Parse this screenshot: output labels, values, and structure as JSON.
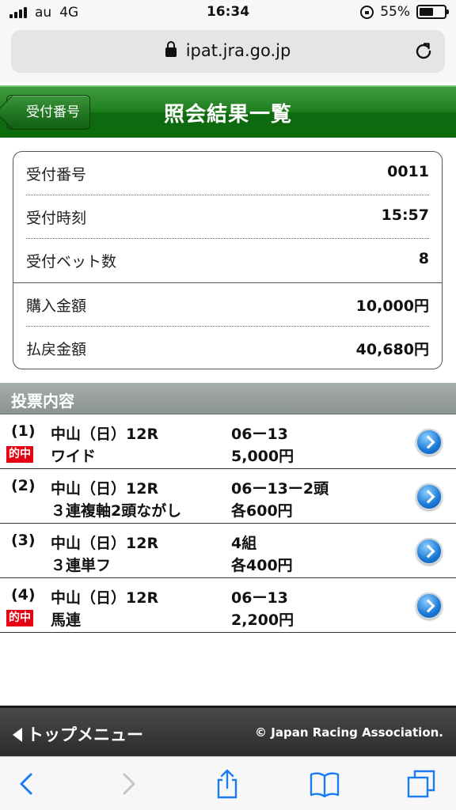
{
  "status_bar": {
    "carrier": "au",
    "network": "4G",
    "time": "16:34",
    "battery": "55%",
    "battery_level": 0.55
  },
  "browser": {
    "url": "ipat.jra.go.jp"
  },
  "header": {
    "back_label": "受付番号",
    "title": "照会結果一覧"
  },
  "summary": [
    {
      "label": "受付番号",
      "value": "0011"
    },
    {
      "label": "受付時刻",
      "value": "15:57"
    },
    {
      "label": "受付ベット数",
      "value": "8"
    },
    {
      "label": "購入金額",
      "value": "10,000円"
    },
    {
      "label": "払戻金額",
      "value": "40,680円"
    }
  ],
  "section_title": "投票内容",
  "tickets": [
    {
      "no": "(1)",
      "badge": "的中",
      "race": "中山（日）12R",
      "bet_type": "ワイド",
      "combination": "06ー13",
      "amount": "5,000円"
    },
    {
      "no": "(2)",
      "badge": "",
      "race": "中山（日）12R",
      "bet_type": "３連複軸2頭ながし",
      "combination": "06ー13ー2頭",
      "amount": "各600円"
    },
    {
      "no": "(3)",
      "badge": "",
      "race": "中山（日）12R",
      "bet_type": "３連単フ",
      "combination": "4組",
      "amount": "各400円"
    },
    {
      "no": "(4)",
      "badge": "的中",
      "race": "中山（日）12R",
      "bet_type": "馬連",
      "combination": "06ー13",
      "amount": "2,200円"
    }
  ],
  "footer": {
    "top_menu": "トップメニュー",
    "copyright": "© Japan Racing Association."
  },
  "colors": {
    "header_green": "#1f7f1f",
    "badge_red": "#e60012",
    "link_blue": "#1a78d6",
    "safari_blue": "#1a7cf5"
  },
  "icons": [
    "signal-icon",
    "orientation-lock-icon",
    "battery-icon",
    "padlock-icon",
    "reload-icon",
    "chevron-right-icon",
    "back-icon",
    "forward-icon",
    "share-icon",
    "bookmarks-icon",
    "tabs-icon"
  ]
}
